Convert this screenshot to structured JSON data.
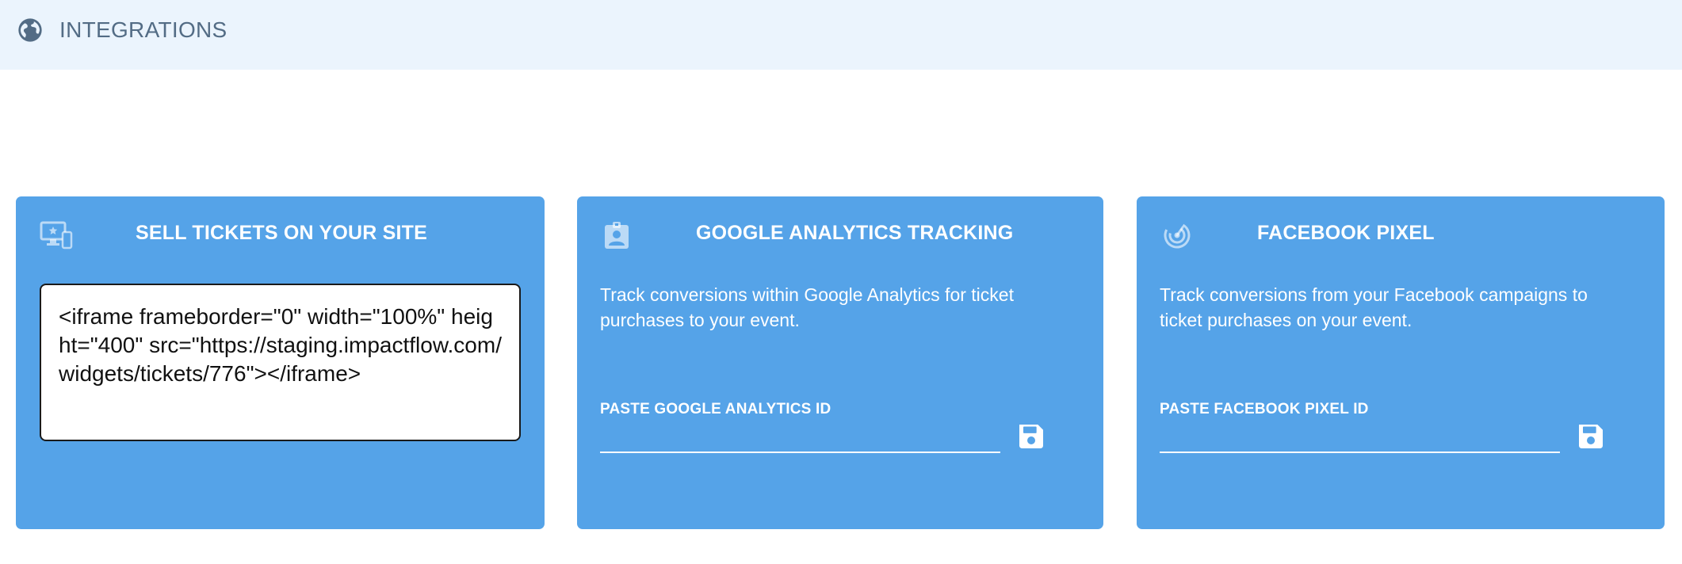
{
  "header": {
    "icon": "globe-icon",
    "title": "INTEGRATIONS",
    "background": "#ebf4fd",
    "text_color": "#536c85"
  },
  "cards": {
    "accent": "#55a3e8",
    "sell_tickets": {
      "icon": "desktop-star-icon",
      "title": "SELL TICKETS ON YOUR SITE",
      "embed_code": "<iframe frameborder=\"0\" width=\"100%\" height=\"400\" src=\"https://staging.impactflow.com/widgets/tickets/776\"></iframe>"
    },
    "google_analytics": {
      "icon": "badge-icon",
      "title": "GOOGLE ANALYTICS TRACKING",
      "description": "Track conversions within Google Analytics for ticket purchases to your event.",
      "field_label": "PASTE GOOGLE ANALYTICS ID",
      "field_value": "",
      "save_icon": "save-icon"
    },
    "facebook_pixel": {
      "icon": "radar-icon",
      "title": "FACEBOOK PIXEL",
      "description": "Track conversions from your Facebook campaigns to ticket purchases on your event.",
      "field_label": "PASTE FACEBOOK PIXEL ID",
      "field_value": "",
      "save_icon": "save-icon"
    }
  }
}
